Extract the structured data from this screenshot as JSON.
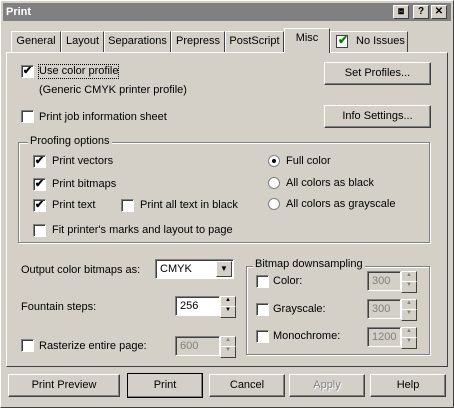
{
  "window": {
    "title": "Print"
  },
  "titlebar_buttons": {
    "rollup": "⧈",
    "help": "?",
    "close": "✕"
  },
  "tabs": [
    {
      "label": "General"
    },
    {
      "label": "Layout"
    },
    {
      "label": "Separations"
    },
    {
      "label": "Prepress"
    },
    {
      "label": "PostScript"
    },
    {
      "label": "Misc"
    },
    {
      "label": "No Issues",
      "icon": "checkmark-page-icon"
    }
  ],
  "misc": {
    "use_color_profile": {
      "label": "Use color profile",
      "checked": true,
      "check": "✔"
    },
    "profile_name": "(Generic CMYK printer profile)",
    "set_profiles_button": "Set Profiles...",
    "print_job_info": {
      "label": "Print job information sheet",
      "checked": false
    },
    "info_settings_button": "Info Settings...",
    "proofing": {
      "title": "Proofing options",
      "print_vectors": {
        "label": "Print vectors",
        "checked": true
      },
      "print_bitmaps": {
        "label": "Print bitmaps",
        "checked": true
      },
      "print_text": {
        "label": "Print text",
        "checked": true
      },
      "print_all_text_black": {
        "label": "Print all text in black",
        "checked": false
      },
      "fit_marks": {
        "label": "Fit printer's marks and layout to page",
        "checked": false
      },
      "color_modes": [
        {
          "label": "Full color",
          "selected": true
        },
        {
          "label": "All colors as black",
          "selected": false
        },
        {
          "label": "All colors as grayscale",
          "selected": false
        }
      ]
    },
    "output_color_bitmaps": {
      "label": "Output color bitmaps as:",
      "value": "CMYK"
    },
    "fountain_steps": {
      "label": "Fountain steps:",
      "value": "256"
    },
    "rasterize": {
      "label": "Rasterize entire page:",
      "checked": false,
      "value": "600"
    },
    "downsampling": {
      "title": "Bitmap downsampling",
      "color": {
        "label": "Color:",
        "value": "300"
      },
      "grayscale": {
        "label": "Grayscale:",
        "value": "300"
      },
      "monochrome": {
        "label": "Monochrome:",
        "value": "1200"
      }
    }
  },
  "footer": {
    "print_preview": "Print Preview",
    "print": "Print",
    "cancel": "Cancel",
    "apply": "Apply",
    "help": "Help"
  }
}
